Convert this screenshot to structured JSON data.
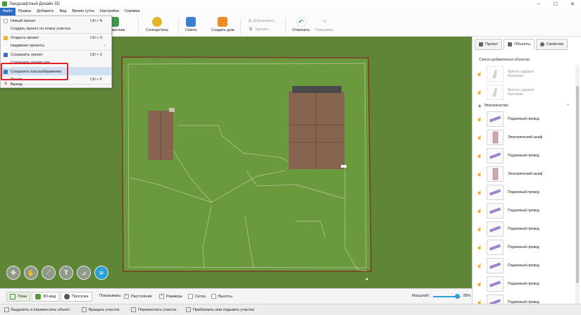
{
  "window": {
    "title": "Ландшафтный Дизайн 3D",
    "controls": [
      "–",
      "☐",
      "✕"
    ]
  },
  "menu": [
    "Файл",
    "Правка",
    "Добавить",
    "Вид",
    "Время суток",
    "Настройки",
    "Справка"
  ],
  "toolbar": {
    "guide": "Справочник",
    "sun": "Солнце/тень",
    "estimate": "Смета",
    "create_house": "Создать дом",
    "duplicate": "Дублировать",
    "delete": "Удалить",
    "undo": "Отменить",
    "redo": "Повторить"
  },
  "file_menu": [
    {
      "label": "Новый проект",
      "shortcut": "Ctrl + N"
    },
    {
      "label": "Создать проект по плану участка",
      "shortcut": ""
    },
    {
      "label": "Открыть проект",
      "shortcut": "Ctrl + O"
    },
    {
      "label": "Недавние проекты",
      "shortcut": "›"
    },
    {
      "label": "Сохранить проект",
      "shortcut": "Ctrl + S"
    },
    {
      "label": "Сохранить проект как...",
      "shortcut": ""
    },
    {
      "label": "Сохранить как изображение",
      "shortcut": ""
    },
    {
      "label": "Печать",
      "shortcut": "Ctrl + P"
    },
    {
      "label": "Выход",
      "shortcut": ""
    }
  ],
  "right_panel": {
    "tabs": [
      "Проект",
      "Объекты",
      "Свойства"
    ],
    "list_title": "Список добавленных объектов",
    "dim_items": [
      {
        "name": "Кресло садовое Кантуюки"
      },
      {
        "name": "Кресло садовое Кантуюки"
      }
    ],
    "group": "Электричество",
    "items": [
      {
        "name": "Подземный провод",
        "kind": "wire"
      },
      {
        "name": "Электрический шкаф",
        "kind": "cabinet"
      },
      {
        "name": "Подземный провод",
        "kind": "wire"
      },
      {
        "name": "Электрический шкаф",
        "kind": "cabinet"
      },
      {
        "name": "Подземный провод",
        "kind": "wire"
      },
      {
        "name": "Подземный провод",
        "kind": "wire"
      },
      {
        "name": "Подземный провод",
        "kind": "wire"
      },
      {
        "name": "Подземный провод",
        "kind": "wire"
      },
      {
        "name": "Подземный провод",
        "kind": "wire"
      },
      {
        "name": "Подземный провод",
        "kind": "wire"
      },
      {
        "name": "Подземный провод",
        "kind": "wire"
      }
    ]
  },
  "view_buttons": [
    "План",
    "3D-вид",
    "Прогулка"
  ],
  "show": {
    "label": "Показывать:",
    "options": [
      {
        "label": "Расстояния",
        "checked": true
      },
      {
        "label": "Размеры",
        "checked": true
      },
      {
        "label": "Сетка",
        "checked": false
      },
      {
        "label": "Высоты",
        "checked": false
      }
    ]
  },
  "zoom": {
    "label": "Масштаб:",
    "value": "85%",
    "fraction": 0.85
  },
  "hints": [
    "Выделить и переместить объект",
    "Вращать участок",
    "Переместить участок",
    "Приблизить или отдалить участок"
  ],
  "colors": {
    "accent": "#2d6fc4",
    "grass": "#5f8537",
    "highlight_box": "#e0202a"
  }
}
